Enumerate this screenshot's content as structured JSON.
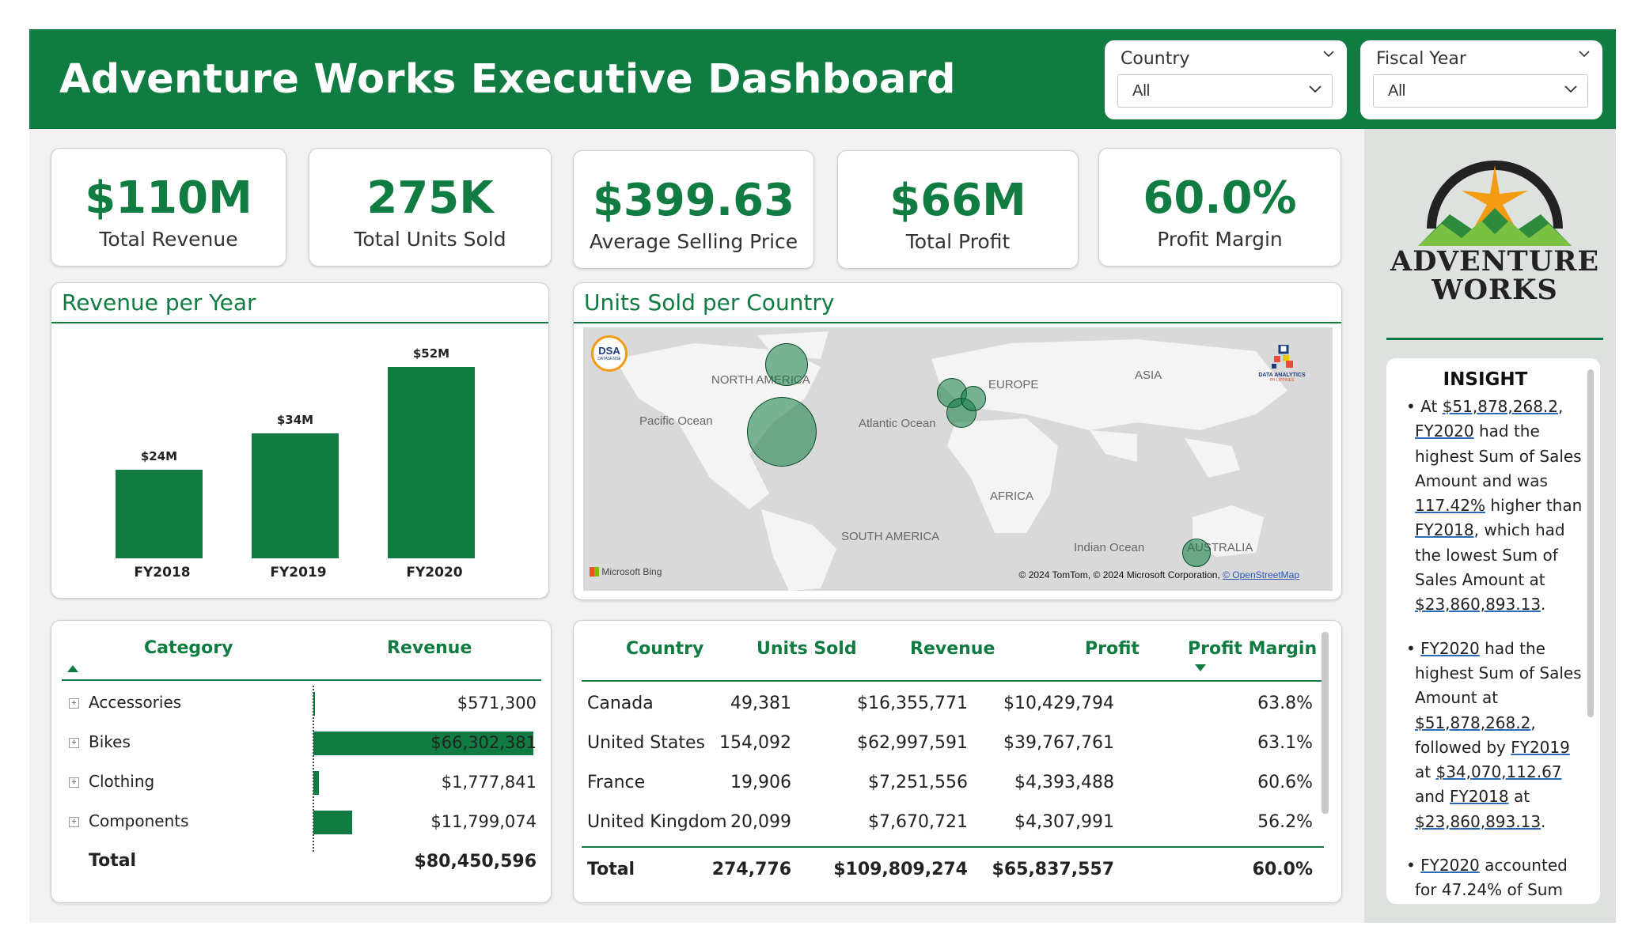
{
  "header": {
    "title": "Adventure Works Executive Dashboard",
    "country_label": "Country",
    "country_value": "All",
    "year_label": "Fiscal Year",
    "year_value": "All"
  },
  "kpis": [
    {
      "value": "$110M",
      "label": "Total Revenue"
    },
    {
      "value": "275K",
      "label": "Total Units Sold"
    },
    {
      "value": "$399.63",
      "label": "Average Selling Price"
    },
    {
      "value": "$66M",
      "label": "Total Profit"
    },
    {
      "value": "60.0%",
      "label": "Profit Margin"
    }
  ],
  "revenue_chart": {
    "title": "Revenue per Year",
    "chart_data": {
      "type": "bar",
      "categories": [
        "FY2018",
        "FY2019",
        "FY2020"
      ],
      "values": [
        24,
        34,
        52
      ],
      "data_labels": [
        "$24M",
        "$34M",
        "$52M"
      ],
      "unit": "$M",
      "ylim": [
        0,
        52
      ]
    }
  },
  "map": {
    "title": "Units Sold per Country",
    "labels": {
      "north_america": "NORTH AMERICA",
      "europe": "EUROPE",
      "asia": "ASIA",
      "pacific": "Pacific Ocean",
      "atlantic": "Atlantic Ocean",
      "africa": "AFRICA",
      "south_america": "SOUTH AMERICA",
      "indian": "Indian Ocean",
      "australia": "AUSTRALIA"
    },
    "bing": "Microsoft Bing",
    "copyright": "© 2024 TomTom, © 2024 Microsoft Corporation,",
    "osm": "© OpenStreetMap",
    "badge_dsa": "DSA",
    "badge_dsa_sub": "DATASENSE",
    "badge_ph": "DATA ANALYTICS",
    "badge_ph_sub": "PH LIPPINES"
  },
  "category_table": {
    "headers": [
      "Category",
      "Revenue"
    ],
    "rows": [
      {
        "name": "Accessories",
        "revenue": "$571,300",
        "value": 571300
      },
      {
        "name": "Bikes",
        "revenue": "$66,302,381",
        "value": 66302381
      },
      {
        "name": "Clothing",
        "revenue": "$1,777,841",
        "value": 1777841
      },
      {
        "name": "Components",
        "revenue": "$11,799,074",
        "value": 11799074
      }
    ],
    "total_label": "Total",
    "total_value": "$80,450,596"
  },
  "country_table": {
    "headers": [
      "Country",
      "Units Sold",
      "Revenue",
      "Profit",
      "Profit Margin"
    ],
    "rows": [
      [
        "Canada",
        "49,381",
        "$16,355,771",
        "$10,429,794",
        "63.8%"
      ],
      [
        "United States",
        "154,092",
        "$62,997,591",
        "$39,767,761",
        "63.1%"
      ],
      [
        "France",
        "19,906",
        "$7,251,556",
        "$4,393,488",
        "60.6%"
      ],
      [
        "United Kingdom",
        "20,099",
        "$7,670,721",
        "$4,307,991",
        "56.2%"
      ]
    ],
    "total": [
      "Total",
      "274,776",
      "$109,809,274",
      "$65,837,557",
      "60.0%"
    ]
  },
  "logo": {
    "line1": "ADVENTURE",
    "line2": "WORKS"
  },
  "insight": {
    "title": "INSIGHT",
    "p1": [
      "At ",
      "$51,878,268.2",
      ", ",
      "FY2020",
      " had the highest Sum of Sales Amount and was ",
      "117.42%",
      " higher than ",
      "FY2018",
      ", which had the lowest Sum of Sales Amount at ",
      "$23,860,893.13",
      "."
    ],
    "p2": [
      "FY2020",
      " had the highest Sum of Sales Amount at ",
      "$51,878,268.2",
      ", followed by ",
      "FY2019",
      " at ",
      "$34,070,112.67",
      " and ",
      "FY2018",
      " at ",
      "$23,860,893.13",
      "."
    ],
    "p3": [
      "FY2020",
      " accounted for 47.24% of Sum"
    ]
  },
  "colors": {
    "brand": "#107c41",
    "panel": "#f2f2f2",
    "sidebar": "#dde2df"
  }
}
